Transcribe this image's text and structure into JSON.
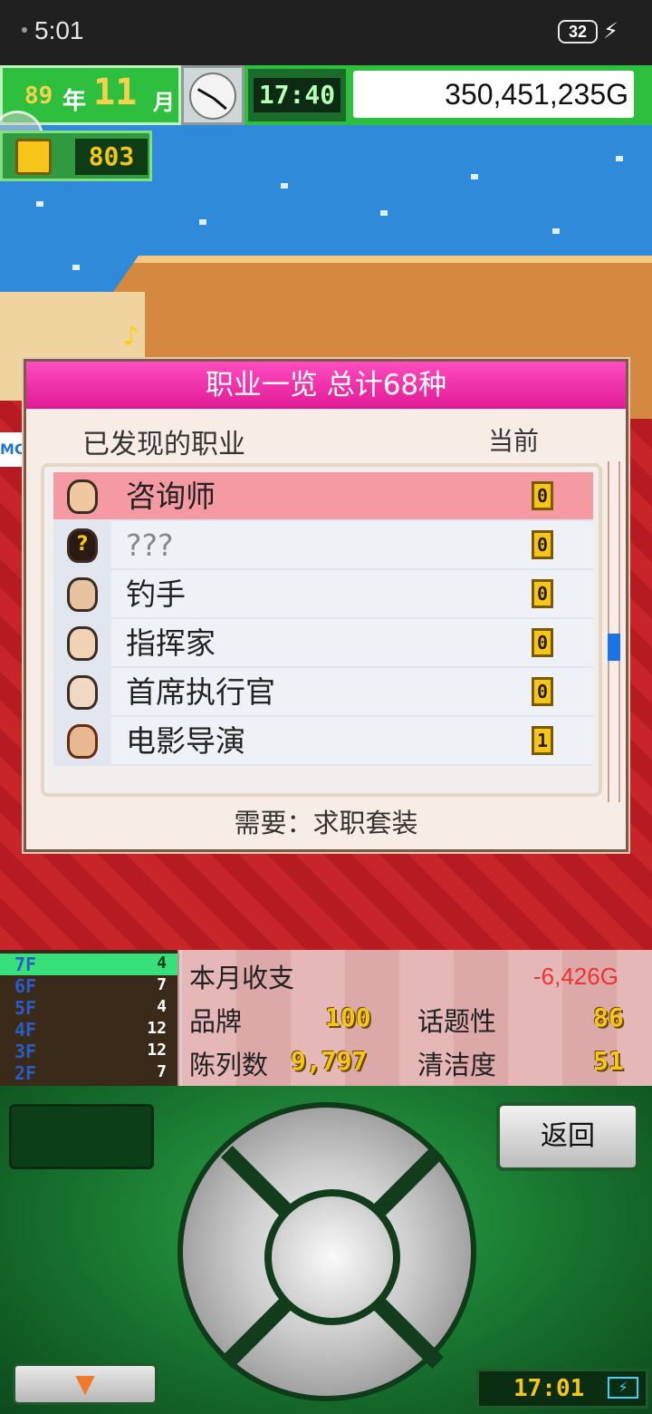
{
  "status_bar": {
    "time": "5:01",
    "battery": "32"
  },
  "hud": {
    "year_num": "89",
    "year_unit": "年",
    "month_num": "11",
    "month_unit": "月",
    "clock": "17:40",
    "money": "350,451,235G",
    "tickets": "803"
  },
  "game": {
    "sign_text": "MC"
  },
  "dialog": {
    "title": "职业一览 总计68种",
    "col_found": "已发现的职业",
    "col_current": "当前",
    "jobs": [
      {
        "name": "咨询师",
        "count": "0",
        "selected": true
      },
      {
        "name": "???",
        "count": "0",
        "unknown": true
      },
      {
        "name": "钓手",
        "count": "0"
      },
      {
        "name": "指挥家",
        "count": "0"
      },
      {
        "name": "首席执行官",
        "count": "0"
      },
      {
        "name": "电影导演",
        "count": "1"
      }
    ],
    "requirement": "需要：求职套装"
  },
  "floors": [
    {
      "label": "7F",
      "value": "4"
    },
    {
      "label": "6F",
      "value": "7"
    },
    {
      "label": "5F",
      "value": "4"
    },
    {
      "label": "4F",
      "value": "12"
    },
    {
      "label": "3F",
      "value": "12"
    },
    {
      "label": "2F",
      "value": "7"
    }
  ],
  "stats": {
    "monthly_label": "本月收支",
    "monthly_value": "-6,426G",
    "brand_label": "品牌",
    "brand_value": "100",
    "topic_label": "话题性",
    "topic_value": "86",
    "display_label": "陈列数",
    "display_value": "9,797",
    "clean_label": "清洁度",
    "clean_value": "51"
  },
  "controller": {
    "back_label": "返回",
    "down_arrow": "▼",
    "clock": "17:01"
  }
}
